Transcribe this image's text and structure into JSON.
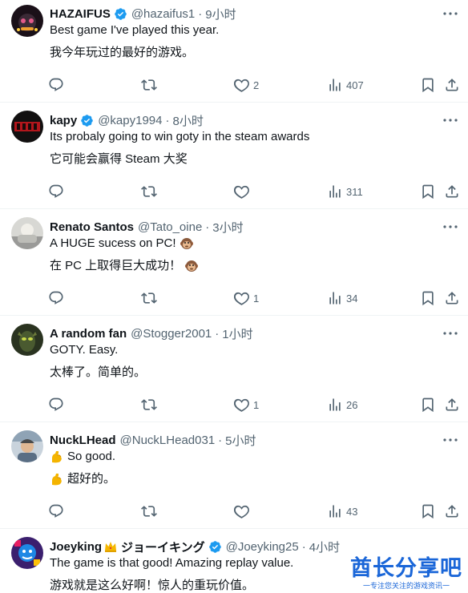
{
  "colors": {
    "text": "#0f1419",
    "secondary": "#536471",
    "verified": "#1d9bf0",
    "divider": "#eff3f4",
    "watermark": "#1a66d8"
  },
  "icons": [
    "verified-badge-icon",
    "more-icon",
    "reply-icon",
    "retweet-icon",
    "like-icon",
    "views-icon",
    "bookmark-icon",
    "share-icon",
    "monkey-emoji-icon",
    "flexed-biceps-emoji-icon",
    "crown-emoji-icon"
  ],
  "replies": [
    {
      "name": "HAZAIFUS",
      "verified": true,
      "handle": "@hazaifus1",
      "dot": "·",
      "time": "9小时",
      "line1": "Best game I've played this year.",
      "line2": "我今年玩过的最好的游戏。",
      "likes": "2",
      "views": "407"
    },
    {
      "name": "kapy",
      "verified": true,
      "handle": "@kapy1994",
      "dot": "·",
      "time": "8小时",
      "line1": "Its probaly going to win goty in the steam awards",
      "line2": "它可能会赢得 Steam 大奖",
      "likes": "",
      "views": "311"
    },
    {
      "name": "Renato Santos",
      "verified": false,
      "handle": "@Tato_oine",
      "dot": "·",
      "time": "3小时",
      "line1": "A HUGE sucess on PC!",
      "line2": "在 PC 上取得巨大成功！",
      "likes": "1",
      "views": "34"
    },
    {
      "name": "A random fan",
      "verified": false,
      "handle": "@Stogger2001",
      "dot": "·",
      "time": "1小时",
      "line1": "GOTY. Easy.",
      "line2": "太棒了。简单的。",
      "likes": "1",
      "views": "26"
    },
    {
      "name": "NuckLHead",
      "verified": false,
      "handle": "@NuckLHead031",
      "dot": "·",
      "time": "5小时",
      "line1": "So good.",
      "line2": "超好的。",
      "likes": "",
      "views": "43"
    },
    {
      "name": "Joeyking",
      "name_extra": "ジョーイキング",
      "verified": true,
      "handle": "@Joeyking25",
      "dot": "·",
      "time": "4小时",
      "line1": "The game is that good! Amazing replay value.",
      "line2": "游戏就是这么好啊！惊人的重玩价值。"
    }
  ],
  "watermark": {
    "main": "酋长分享吧",
    "sub": "一专注您关注的游戏资讯一"
  }
}
